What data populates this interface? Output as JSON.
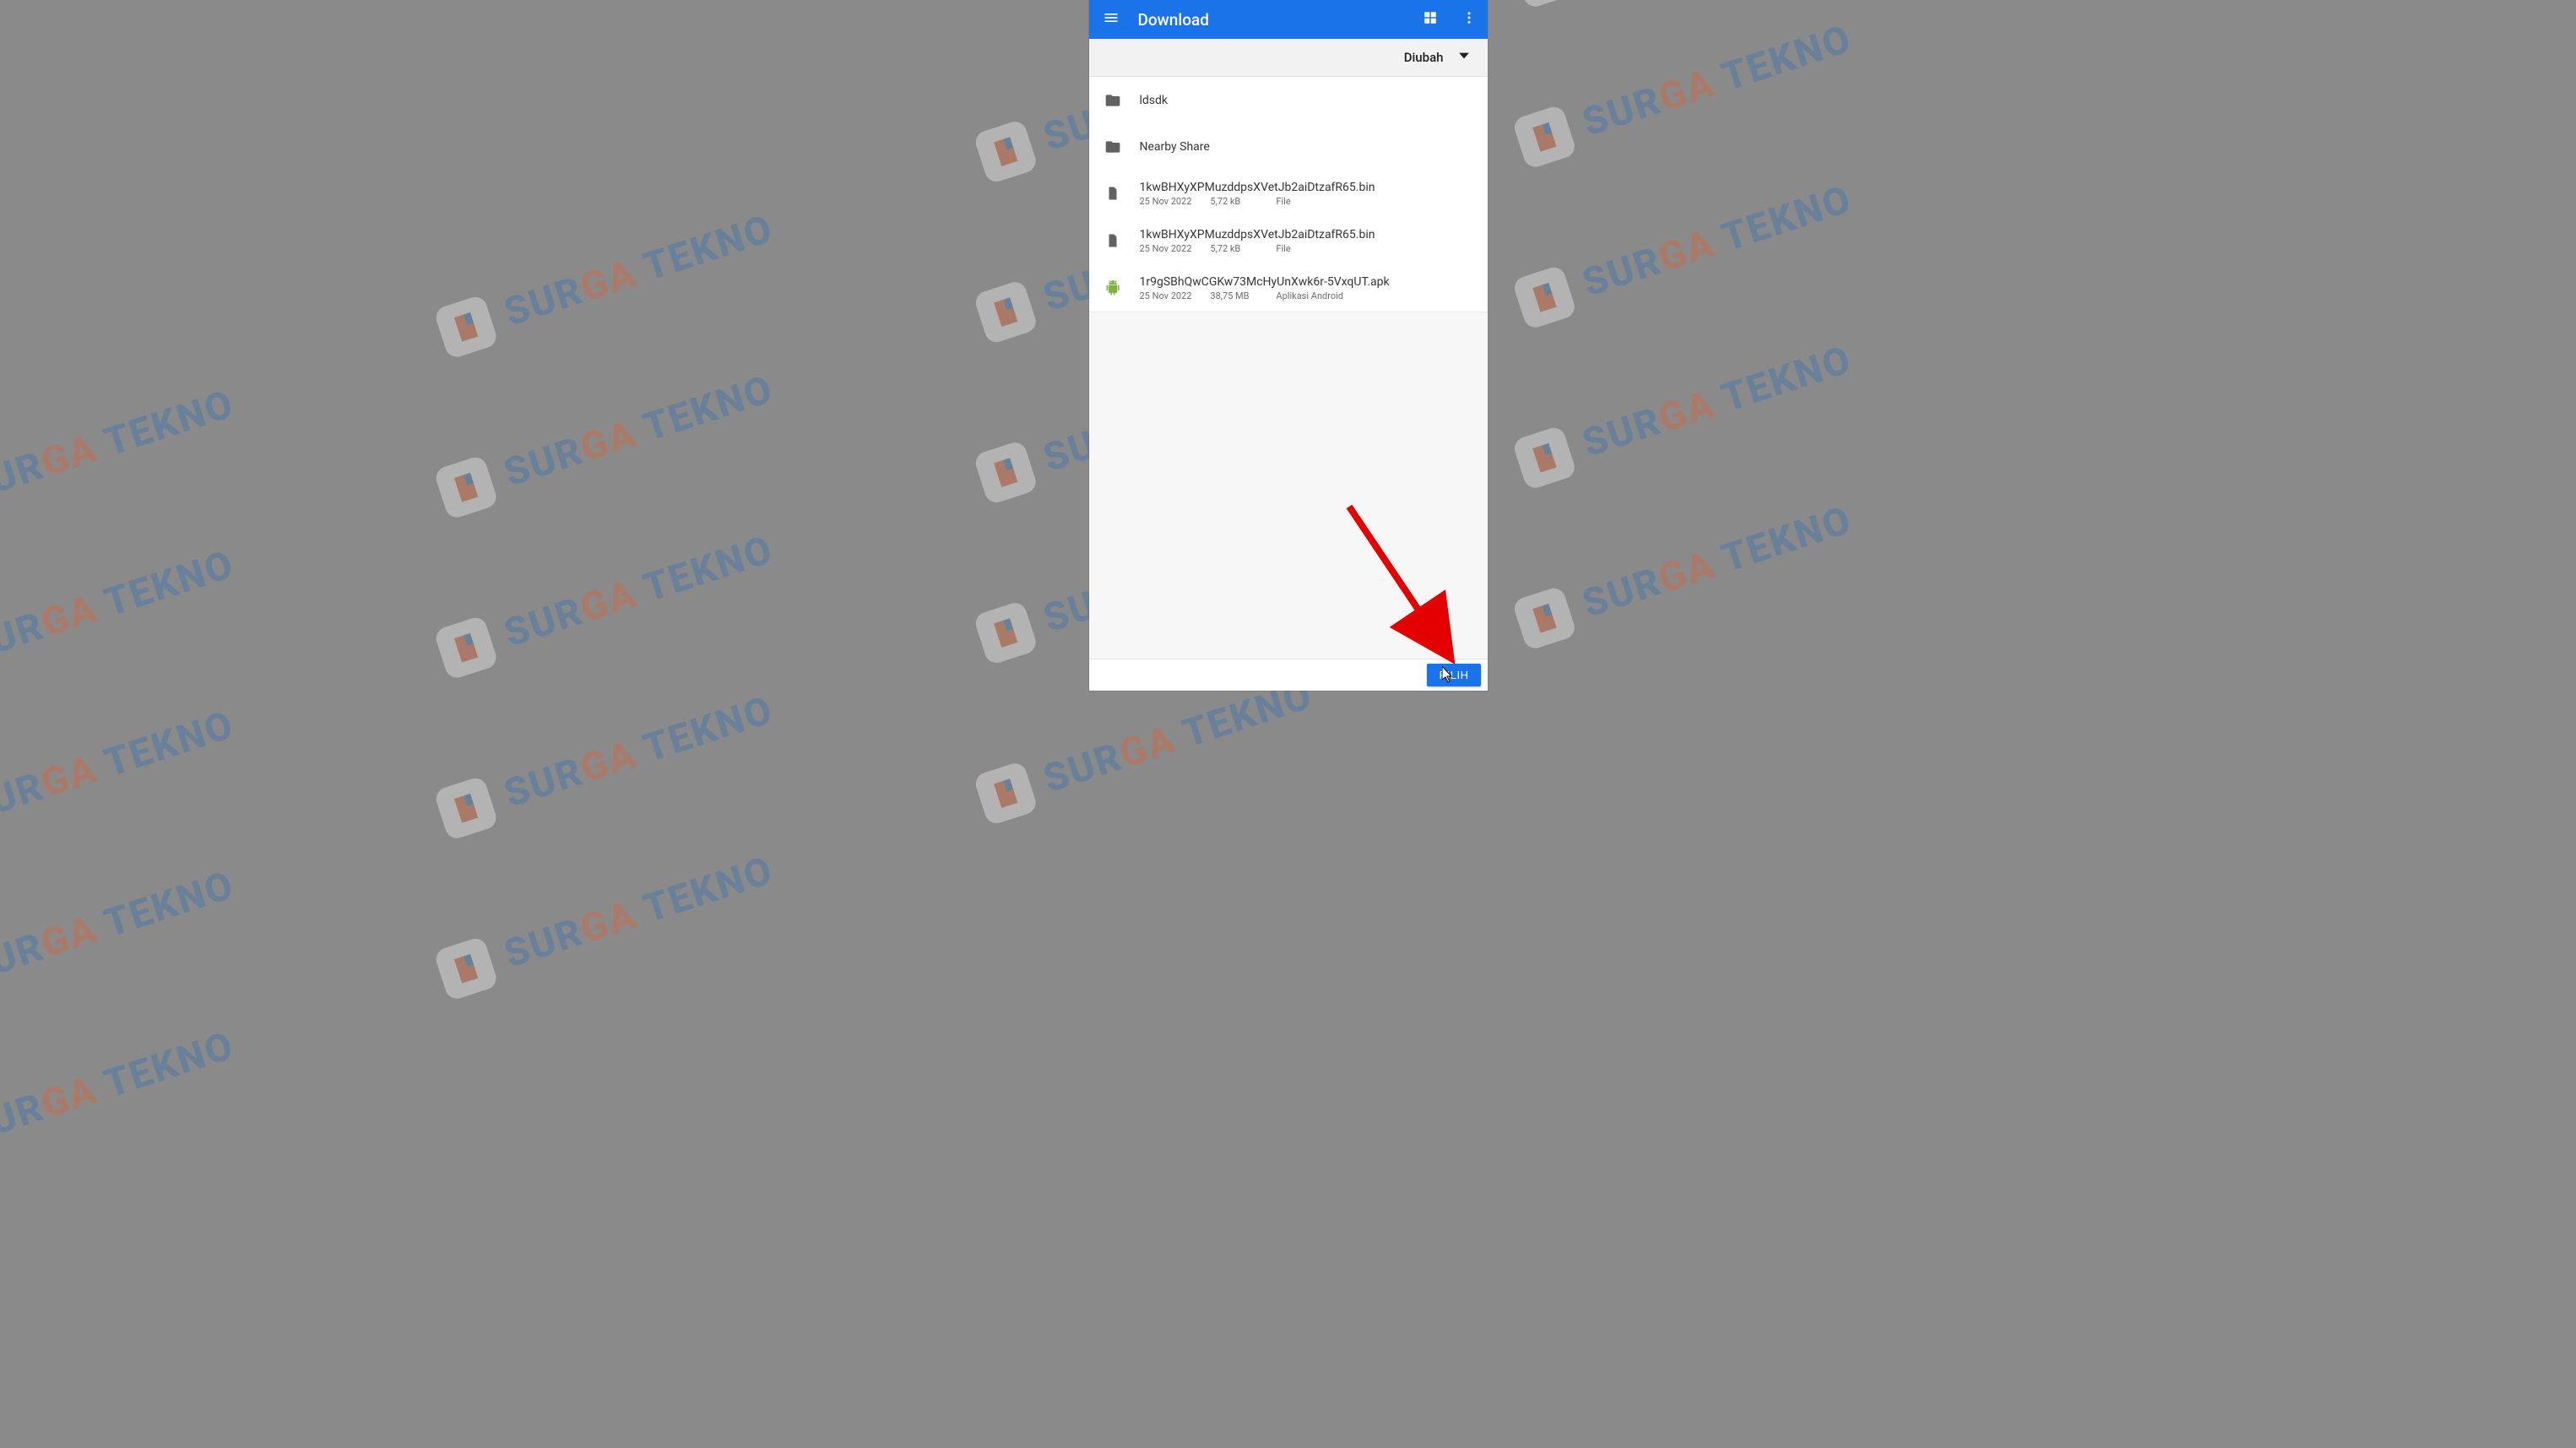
{
  "watermark": {
    "text_a": "SUR",
    "text_b": "GA",
    "text_c": " TEKNO"
  },
  "appbar": {
    "title": "Download"
  },
  "sort": {
    "label": "Diubah"
  },
  "items": [
    {
      "kind": "folder",
      "name": "ldsdk"
    },
    {
      "kind": "folder",
      "name": "Nearby Share"
    },
    {
      "kind": "file",
      "name": "1kwBHXyXPMuzddpsXVetJb2aiDtzafR65.bin",
      "date": "25 Nov 2022",
      "size": "5,72 kB",
      "type": "File"
    },
    {
      "kind": "file",
      "name": "1kwBHXyXPMuzddpsXVetJb2aiDtzafR65.bin",
      "date": "25 Nov 2022",
      "size": "5,72 kB",
      "type": "File"
    },
    {
      "kind": "apk",
      "name": "1r9gSBhQwCGKw73McHyUnXwk6r-5VxqUT.apk",
      "date": "25 Nov 2022",
      "size": "38,75 MB",
      "type": "Aplikasi Android"
    }
  ],
  "button": {
    "select": "PILIH"
  }
}
